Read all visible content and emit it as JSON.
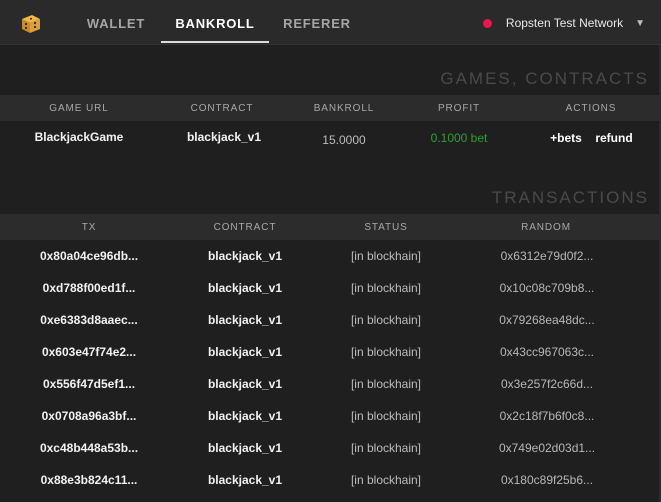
{
  "topbar": {
    "tabs": [
      {
        "label": "WALLET",
        "active": false
      },
      {
        "label": "BANKROLL",
        "active": true
      },
      {
        "label": "REFERER",
        "active": false
      }
    ],
    "network": {
      "label": "Ropsten Test Network",
      "status_color": "#e8174c"
    }
  },
  "games": {
    "title": "GAMES, CONTRACTS",
    "headers": [
      "GAME URL",
      "CONTRACT",
      "BANKROLL",
      "PROFIT",
      "ACTIONS"
    ],
    "row": {
      "game_url": "BlackjackGame",
      "contract": "blackjack_v1",
      "bankroll": "15.0000",
      "profit": "0.1000 bet",
      "action_bets": "+bets",
      "action_refund": "refund"
    }
  },
  "transactions": {
    "title": "TRANSACTIONS",
    "headers": [
      "TX",
      "CONTRACT",
      "STATUS",
      "RANDOM"
    ],
    "rows": [
      {
        "tx": "0x80a04ce96db...",
        "contract": "blackjack_v1",
        "status": "[in blockhain]",
        "random": "0x6312e79d0f2..."
      },
      {
        "tx": "0xd788f00ed1f...",
        "contract": "blackjack_v1",
        "status": "[in blockhain]",
        "random": "0x10c08c709b8..."
      },
      {
        "tx": "0xe6383d8aaec...",
        "contract": "blackjack_v1",
        "status": "[in blockhain]",
        "random": "0x79268ea48dc..."
      },
      {
        "tx": "0x603e47f74e2...",
        "contract": "blackjack_v1",
        "status": "[in blockhain]",
        "random": "0x43cc967063c..."
      },
      {
        "tx": "0x556f47d5ef1...",
        "contract": "blackjack_v1",
        "status": "[in blockhain]",
        "random": "0x3e257f2c66d..."
      },
      {
        "tx": "0x0708a96a3bf...",
        "contract": "blackjack_v1",
        "status": "[in blockhain]",
        "random": "0x2c18f7b6f0c8..."
      },
      {
        "tx": "0xc48b448a53b...",
        "contract": "blackjack_v1",
        "status": "[in blockhain]",
        "random": "0x749e02d03d1..."
      },
      {
        "tx": "0x88e3b824c11...",
        "contract": "blackjack_v1",
        "status": "[in blockhain]",
        "random": "0x180c89f25b6..."
      }
    ]
  },
  "colors": {
    "background": "#1f1f20",
    "topbar": "#2a2a2b",
    "accent_profit": "#2ea12e",
    "logo": "#d9a441"
  },
  "icons": {
    "logo": "dice-logo-icon",
    "network_status": "network-status-dot-icon",
    "dropdown": "chevron-down-icon"
  }
}
